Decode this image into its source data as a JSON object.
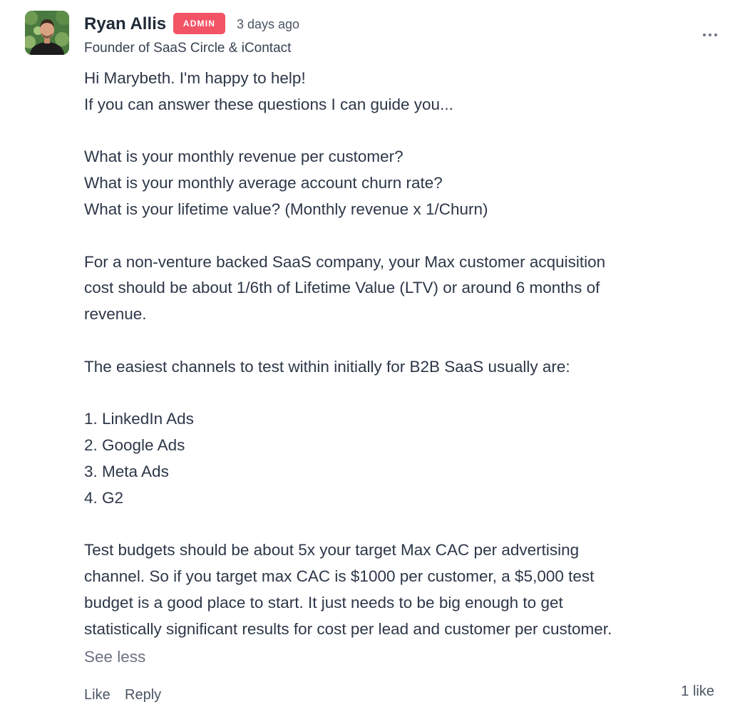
{
  "author": {
    "name": "Ryan Allis",
    "badge": "ADMIN",
    "timestamp": "3 days ago",
    "headline": "Founder of SaaS Circle & iContact"
  },
  "colors": {
    "badge_bg": "#f25466",
    "text": "#2d3748",
    "muted": "#6b7280"
  },
  "icons": {
    "menu": "more-horizontal-icon"
  },
  "body": {
    "lines": [
      "Hi Marybeth. I'm happy to help!",
      "If you can answer these questions I can guide you...",
      "",
      "What is your monthly revenue per customer?",
      "What is your monthly average account churn rate?",
      "What is your lifetime value? (Monthly revenue x 1/Churn)",
      "",
      "For a non-venture backed SaaS company, your Max customer acquisition",
      "cost should be about 1/6th of Lifetime Value (LTV) or around 6 months of",
      "revenue.",
      "",
      "The easiest channels to test within initially for B2B SaaS usually are:",
      "",
      "1. LinkedIn Ads",
      "2. Google Ads",
      "3. Meta Ads",
      "4. G2",
      "",
      "Test budgets should be about 5x your target Max CAC per advertising",
      "channel. So if you target max CAC is $1000 per customer, a $5,000 test",
      "budget is a good place to start. It just needs to be big enough to get",
      "statistically significant results for cost per lead and customer per customer."
    ],
    "see_less": "See less"
  },
  "actions": {
    "like": "Like",
    "reply": "Reply",
    "like_count": "1 like"
  }
}
